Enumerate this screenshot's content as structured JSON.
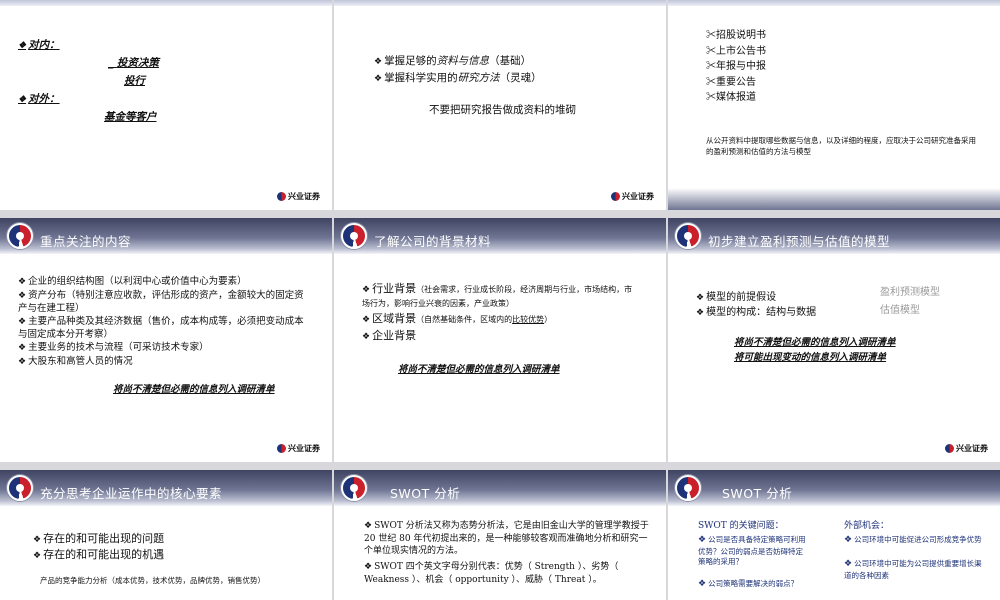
{
  "slides": {
    "s1": {
      "internal_label": "对内：",
      "internal_items": [
        "投资决策",
        "投行"
      ],
      "external_label": "对外：",
      "external_items": [
        "基金等客户"
      ],
      "brand": "兴业证券"
    },
    "s2": {
      "items": [
        {
          "prefix": "掌握足够的",
          "em": "资料与信息",
          "suffix": "（基础）"
        },
        {
          "prefix": "掌握科学实用的",
          "em": "研究方法",
          "suffix": "（灵魂）"
        }
      ],
      "note": "不要把研究报告做成资料的堆砌",
      "brand": "兴业证券"
    },
    "s3": {
      "sources": [
        "招股说明书",
        "上市公告书",
        "年报与中报",
        "重要公告",
        "媒体报道"
      ],
      "note": "从公开资料中提取哪些数据与信息，以及详细的程度，应取决于公司研究准备采用的盈利预测和估值的方法与模型"
    },
    "s4": {
      "title": "重点关注的内容",
      "items": [
        "企业的组织结构图（以利润中心或价值中心为要素）",
        "资产分布（特别注意应收款，评估形成的资产，金额较大的固定资产与在建工程）",
        "主要产品种类及其经济数据（售价，成本构成等，必须把变动成本与固定成本分开考察）",
        "主要业务的技术与流程（可采访技术专家）",
        "大股东和高管人员的情况"
      ],
      "note": "将尚不清楚但必需的信息列入调研清单",
      "brand": "兴业证券"
    },
    "s5": {
      "title": "了解公司的背景材料",
      "industry_label": "行业背景",
      "industry_detail": "（社会需求，行业成长阶段，经济周期与行业，市场结构，市场行为，影响行业兴衰的因素，产业政策）",
      "region_label": "区域背景",
      "region_detail_prefix": "（自然基础条件，区域内的",
      "region_detail_em": "比较优势",
      "region_detail_suffix": "）",
      "company_label": "企业背景",
      "note": "将尚不清楚但必需的信息列入调研清单"
    },
    "s6": {
      "title": "初步建立盈利预测与估值的模型",
      "items": [
        "模型的前提假设",
        "模型的构成：结构与数据"
      ],
      "side_labels": [
        "盈利预测模型",
        "估值模型"
      ],
      "notes": [
        "将尚不清楚但必需的信息列入调研清单",
        "将可能出现变动的信息列入调研清单"
      ],
      "brand": "兴业证券"
    },
    "s7": {
      "title": "充分思考企业运作中的核心要素",
      "items": [
        "存在的和可能出现的问题",
        "存在的和可能出现的机遇"
      ],
      "analysis": "产品的竞争能力分析（成本优势，技术优势，品牌优势，销售优势）"
    },
    "s8": {
      "title": "SWOT 分析",
      "items": [
        "SWOT 分析法又称为态势分析法，它是由旧金山大学的管理学教授于 20 世纪 80 年代初提出来的，是一种能够较客观而准确地分析和研究一个单位现实情况的方法。",
        "SWOT 四个英文字母分别代表：优势（ Strength ）、劣势（ Weakness ）、机会（ opportunity ）、威胁（ Threat ）。"
      ]
    },
    "s9": {
      "title": "SWOT 分析",
      "left_head": "SWOT  的关键问题：",
      "left_items": [
        "公司是否具备特定策略可利用优势？公司的弱点是否妨碍特定策略的采用？",
        "公司策略需要解决的弱点？"
      ],
      "right_head": "外部机会：",
      "right_items": [
        "公司环境中可能促进公司形成竞争优势",
        "公司环境中可能为公司提供重要增长渠道的各种因素"
      ]
    }
  }
}
